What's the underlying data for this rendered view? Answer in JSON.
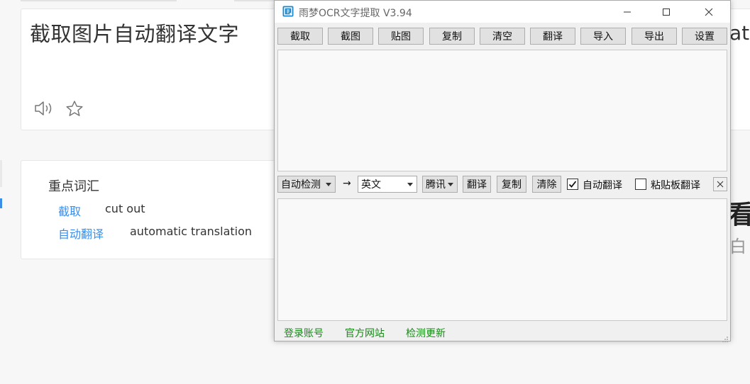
{
  "background_page": {
    "source_text": "截取图片自动翻译文字",
    "vocab": {
      "title": "重点词汇",
      "items": [
        {
          "term": "截取",
          "definition": "cut out"
        },
        {
          "term": "自动翻译",
          "definition": "automatic translation"
        }
      ]
    },
    "right_peek_text": "atio",
    "right_peek_big": "看",
    "right_peek_small": "白月"
  },
  "ocr_window": {
    "title": "雨梦OCR文字提取 V3.94",
    "toolbar": [
      "截取",
      "截图",
      "贴图",
      "复制",
      "清空",
      "翻译",
      "导入",
      "导出",
      "设置"
    ],
    "translate_row": {
      "source_lang": "自动检测",
      "arrow": "→",
      "target_lang": "英文",
      "engine": "腾讯",
      "translate_label": "翻译",
      "copy_label": "复制",
      "clear_label": "清除",
      "auto_translate_label": "自动翻译",
      "auto_translate_checked": true,
      "clipboard_translate_label": "粘贴板翻译",
      "clipboard_translate_checked": false
    },
    "ocr_text": "",
    "translated_text": "",
    "footer_links": [
      "登录账号",
      "官方网站",
      "检测更新"
    ],
    "colors": {
      "link": "#168a16",
      "accent": "#3b8ee8"
    }
  }
}
